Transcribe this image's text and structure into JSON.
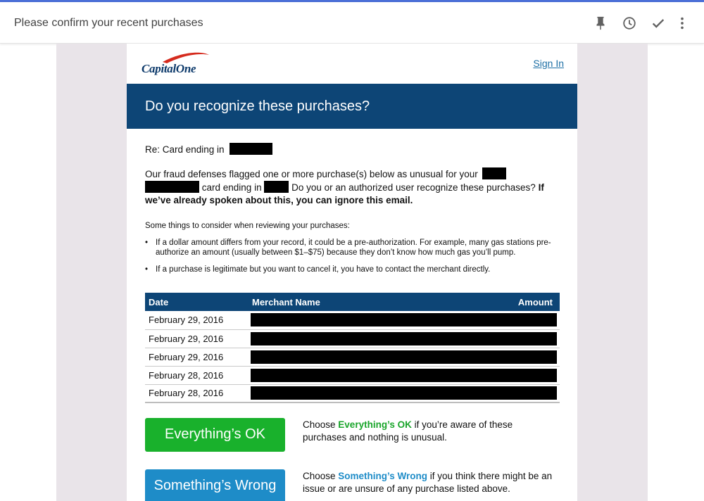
{
  "header": {
    "subject": "Please confirm your recent purchases",
    "icons": [
      "pin-icon",
      "clock-icon",
      "check-icon",
      "more-vert-icon"
    ]
  },
  "email": {
    "logo_text": "CapitalOne",
    "sign_in": "Sign In",
    "banner_title": "Do you recognize these purchases?",
    "re_line": "Re: Card ending in",
    "fraud_p1": "Our fraud defenses flagged one or more purchase(s) below as unusual for your",
    "fraud_p2": "card ending in",
    "fraud_p3": "Do you or an authorized user recognize these purchases?",
    "fraud_bold": "If we’ve already spoken about this, you can ignore this email.",
    "consider_title": "Some things to consider when reviewing your purchases:",
    "bullets": [
      "If a dollar amount differs from your record, it could be a pre-authorization. For example, many gas stations pre-authorize an amount (usually between $1–$75) because they don’t know how much gas you’ll pump.",
      "If a purchase is legitimate but you want to cancel it, you have to contact the merchant directly."
    ],
    "table": {
      "headers": {
        "date": "Date",
        "merchant": "Merchant Name",
        "amount": "Amount"
      },
      "rows": [
        {
          "date": "February 29, 2016"
        },
        {
          "date": "February 29, 2016"
        },
        {
          "date": "February 29, 2016"
        },
        {
          "date": "February 28, 2016"
        },
        {
          "date": "February 28, 2016"
        }
      ]
    },
    "ok_button": "Everything’s OK",
    "ok_text_pre": "Choose ",
    "ok_text_hl": "Everything’s OK",
    "ok_text_post": " if you’re aware of these purchases and nothing is unusual.",
    "wrong_button": "Something’s Wrong",
    "wrong_text_pre": "Choose ",
    "wrong_text_hl": "Something’s Wrong",
    "wrong_text_post": " if you think there might be an issue or are unsure of any purchase listed above."
  },
  "colors": {
    "brand_navy": "#0d4576",
    "ok_green": "#19b12c",
    "wrong_blue": "#1e8cc8",
    "logo_swoosh": "#d52b1e"
  }
}
